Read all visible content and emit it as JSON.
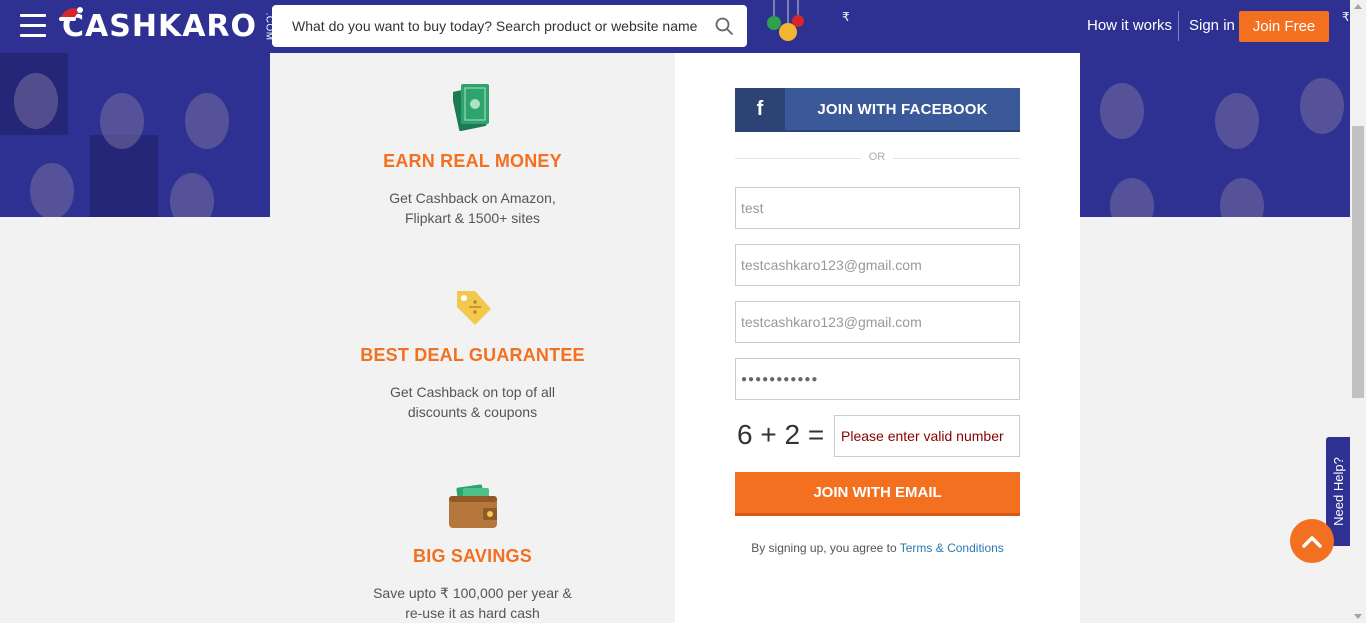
{
  "header": {
    "logo_text": "CASHKARO",
    "logo_suffix": ".COM",
    "search_placeholder": "What do you want to buy today? Search product or website name",
    "rupee_symbol": "₹",
    "nav": {
      "how_it_works": "How it works",
      "sign_in": "Sign in",
      "join_free": "Join Free"
    }
  },
  "features": [
    {
      "title": "EARN REAL MONEY",
      "desc_line1": "Get Cashback on Amazon,",
      "desc_line2": "Flipkart & 1500+ sites",
      "icon": "money-icon"
    },
    {
      "title": "BEST DEAL GUARANTEE",
      "desc_line1": "Get Cashback on top of all",
      "desc_line2": "discounts & coupons",
      "icon": "price-tag-icon"
    },
    {
      "title": "BIG SAVINGS",
      "desc_line1": "Save upto ₹ 100,000 per year &",
      "desc_line2": "re-use it as hard cash",
      "icon": "wallet-icon"
    }
  ],
  "form": {
    "facebook_icon_letter": "f",
    "facebook_label": "JOIN WITH FACEBOOK",
    "or_text": "OR",
    "name_value": "test",
    "email_value": "testcashkaro123@gmail.com",
    "confirm_email_value": "testcashkaro123@gmail.com",
    "password_mask": "●●●●●●●●●●●",
    "captcha_question": "6 + 2 =",
    "captcha_value": "Please enter valid number",
    "email_button_label": "JOIN WITH EMAIL",
    "terms_prefix": "By signing up, you agree to ",
    "terms_link": "Terms & Conditions"
  },
  "widgets": {
    "need_help": "Need Help?"
  },
  "colors": {
    "brand_blue": "#2e3192",
    "brand_orange": "#f37021",
    "facebook_blue": "#3b5998"
  }
}
